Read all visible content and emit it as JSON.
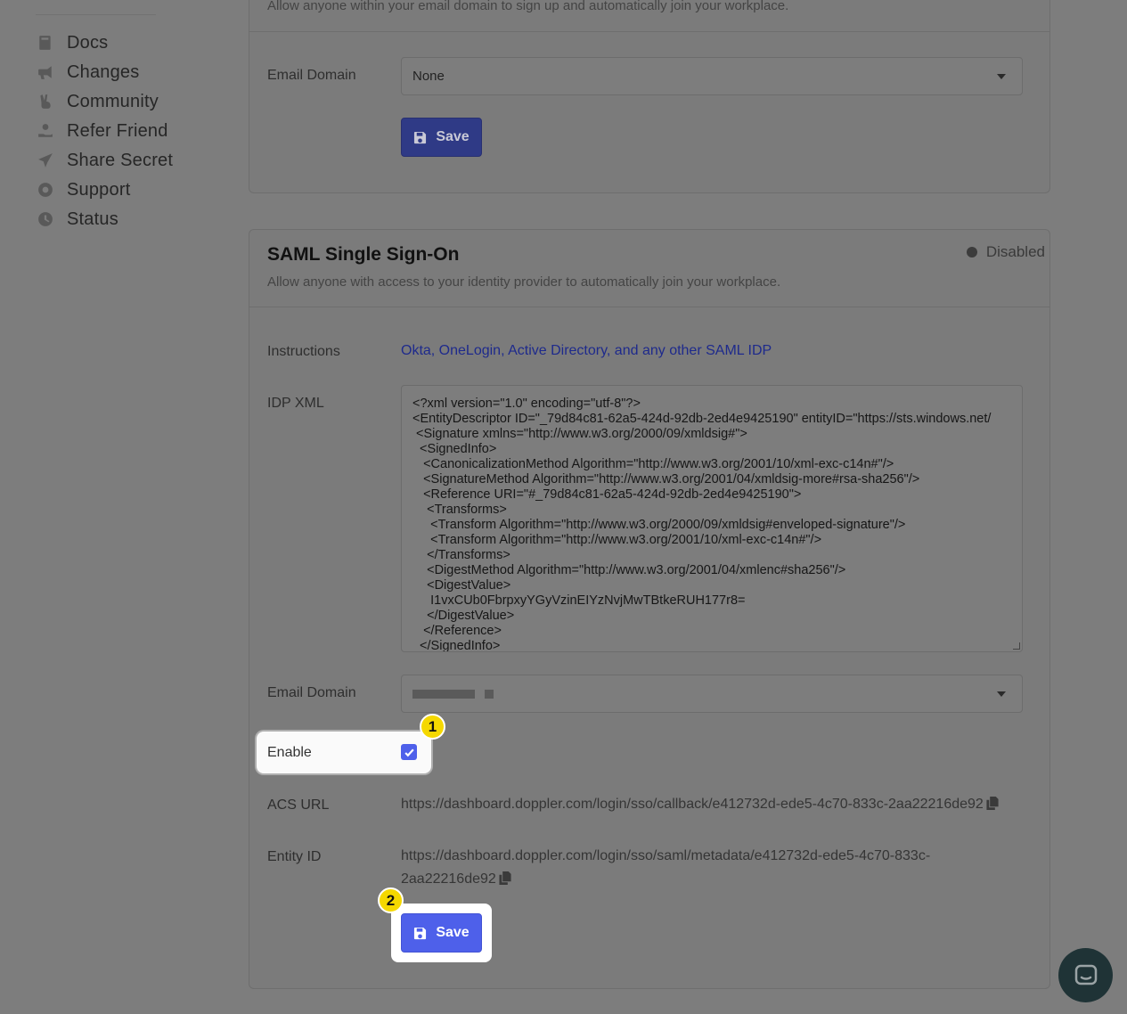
{
  "sidebar": {
    "items": [
      {
        "label": "Docs",
        "icon": "book-icon"
      },
      {
        "label": "Changes",
        "icon": "megaphone-icon"
      },
      {
        "label": "Community",
        "icon": "peace-hand-icon"
      },
      {
        "label": "Refer Friend",
        "icon": "hand-holding-icon"
      },
      {
        "label": "Share Secret",
        "icon": "paper-plane-icon"
      },
      {
        "label": "Support",
        "icon": "life-ring-icon"
      },
      {
        "label": "Status",
        "icon": "clock-icon"
      }
    ]
  },
  "domain_card": {
    "description": "Allow anyone within your email domain to sign up and automatically join your workplace.",
    "email_domain_label": "Email Domain",
    "email_domain_value": "None",
    "save_label": "Save"
  },
  "saml_card": {
    "title": "SAML Single Sign-On",
    "status": "Disabled",
    "description": "Allow anyone with access to your identity provider to automatically join your workplace.",
    "instructions_label": "Instructions",
    "instructions_link": "Okta, OneLogin, Active Directory, and any other SAML IDP",
    "idp_xml_label": "IDP XML",
    "idp_xml_lines": [
      "<?xml version=\"1.0\" encoding=\"utf-8\"?>",
      "<EntityDescriptor ID=\"_79d84c81-62a5-424d-92db-2ed4e9425190\" entityID=\"https://sts.windows.net/",
      " <Signature xmlns=\"http://www.w3.org/2000/09/xmldsig#\">",
      "  <SignedInfo>",
      "   <CanonicalizationMethod Algorithm=\"http://www.w3.org/2001/10/xml-exc-c14n#\"/>",
      "   <SignatureMethod Algorithm=\"http://www.w3.org/2001/04/xmldsig-more#rsa-sha256\"/>",
      "   <Reference URI=\"#_79d84c81-62a5-424d-92db-2ed4e9425190\">",
      "    <Transforms>",
      "     <Transform Algorithm=\"http://www.w3.org/2000/09/xmldsig#enveloped-signature\"/>",
      "     <Transform Algorithm=\"http://www.w3.org/2001/10/xml-exc-c14n#\"/>",
      "    </Transforms>",
      "    <DigestMethod Algorithm=\"http://www.w3.org/2001/04/xmlenc#sha256\"/>",
      "    <DigestValue>",
      "     I1vxCUb0FbrpxyYGyVzinEIYzNvjMwTBtkeRUH177r8=",
      "    </DigestValue>",
      "   </Reference>",
      "  </SignedInfo>"
    ],
    "email_domain_label": "Email Domain",
    "enable_label": "Enable",
    "enable_checked": true,
    "acs_url_label": "ACS URL",
    "acs_url": "https://dashboard.doppler.com/login/sso/callback/e412732d-ede5-4c70-833c-2aa22216de92",
    "entity_id_label": "Entity ID",
    "entity_id_line1": "https://dashboard.doppler.com/login/sso/saml/metadata/e412732d-ede5-4c70-833c-",
    "entity_id_line2": "2aa22216de92",
    "save_label": "Save"
  },
  "annotations": {
    "step1": "1",
    "step2": "2"
  },
  "colors": {
    "accent": "#4e60ea",
    "badge": "#f5d800"
  }
}
